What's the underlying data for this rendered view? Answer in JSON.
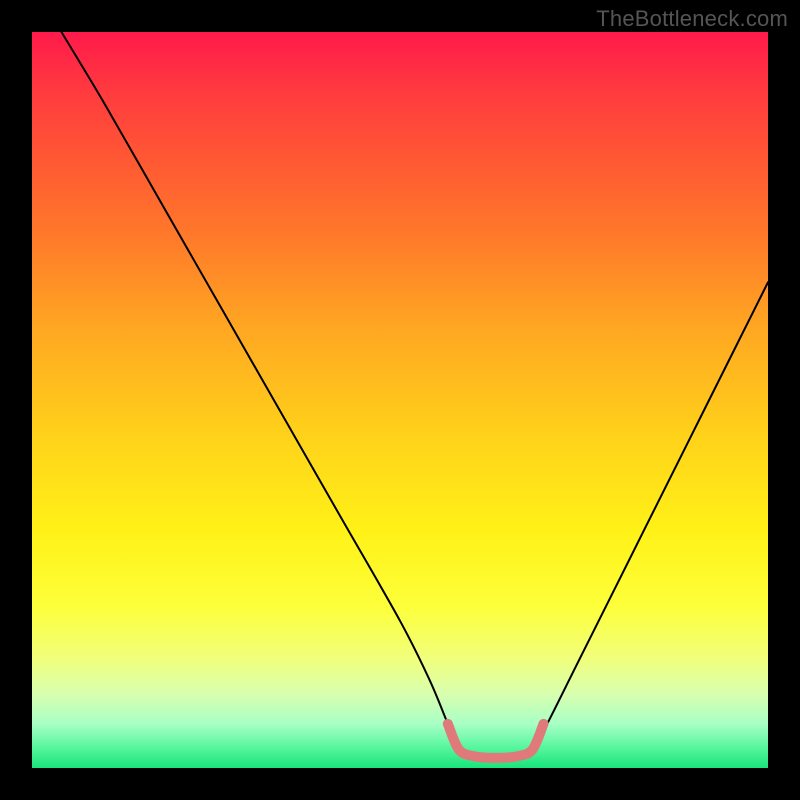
{
  "watermark": "TheBottleneck.com",
  "chart_data": {
    "type": "line",
    "title": "",
    "xlabel": "",
    "ylabel": "",
    "xlim": [
      0,
      100
    ],
    "ylim": [
      0,
      100
    ],
    "series": [
      {
        "name": "black-curve",
        "color": "#000000",
        "stroke_width": 2,
        "x": [
          4,
          10,
          18,
          26,
          34,
          42,
          50,
          54,
          56.5,
          58,
          62,
          66,
          68,
          70,
          74,
          80,
          86,
          92,
          98,
          100
        ],
        "y": [
          100,
          90,
          76,
          62,
          48,
          34,
          20,
          12,
          6,
          2.5,
          1.5,
          1.5,
          2.5,
          6,
          14,
          26,
          38,
          50,
          62,
          66
        ]
      },
      {
        "name": "pink-valley-segment",
        "color": "#e07a7a",
        "stroke_width": 10,
        "x": [
          56.5,
          58,
          60,
          62,
          64,
          66,
          68,
          69.5
        ],
        "y": [
          6,
          2.5,
          1.6,
          1.4,
          1.4,
          1.6,
          2.5,
          6
        ]
      }
    ],
    "background_gradient": {
      "top": "#ff1a4b",
      "bottom": "#18e47a",
      "via": [
        "#ff7a2a",
        "#ffd21a",
        "#fdff3a"
      ]
    }
  }
}
